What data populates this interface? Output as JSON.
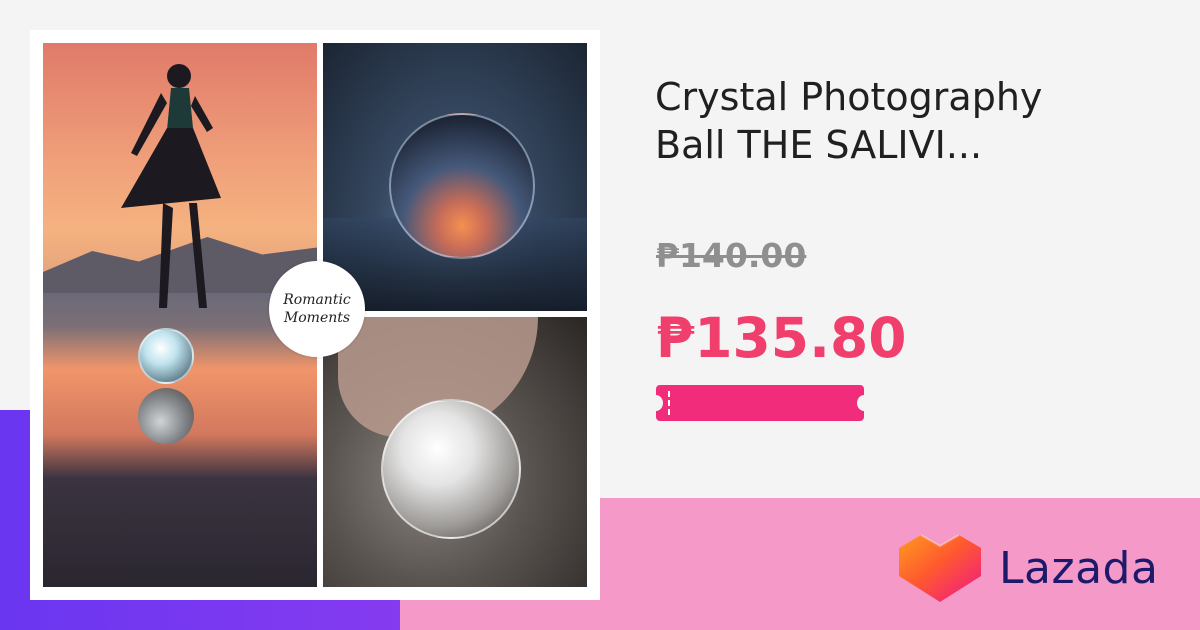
{
  "product": {
    "title_line1": "Crystal Photography",
    "title_line2": "Ball THE SALIVI...",
    "original_price": "₱140.00",
    "sale_price": "₱135.80",
    "image_badge_text": "Romantic\nMoments"
  },
  "brand": {
    "name": "Lazada",
    "logo_icon": "lazada-heart-icon"
  },
  "colors": {
    "sale_price": "#f13f6d",
    "original_price": "#8f8f8f",
    "voucher": "#f02c7b",
    "purple_band": "#6a36f0",
    "pink_band": "#f59ac8",
    "brand_text": "#1e1a6b"
  }
}
